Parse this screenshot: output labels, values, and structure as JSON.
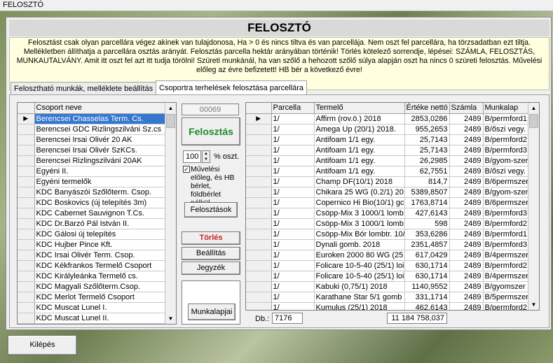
{
  "window_title": "FELOSZTÓ",
  "header_title": "FELOSZTÓ",
  "info_text": "Felosztást csak olyan parcellára végez akinek van tulajdonosa, Ha > 0 és nincs tiltva és van parcellája. Nem oszt fel parcellára, ha törzsadatban ezt tiltja. Mellékletben állíthatja a parcellára osztás arányát. Felosztás parcella hektár arányában történik! Törlés kötelező sorrendje, lépései: SZÁMLA, FELOSZTÁS, MUNKAUTALVÁNY. Amit itt oszt fel azt itt tudja törölni! Szüreti munkánál, ha van szőlő a hehozott szőlő súlya alapján oszt ha nincs 0 szüreti felosztás. Művelési előleg az évre befizetett! HB bér a következő évre!",
  "tabs": [
    {
      "label": "Feloszthatό munkák, melléklete beállítás"
    },
    {
      "label": "Csoportra terhelések felosztása parcellára"
    }
  ],
  "left_grid": {
    "header": "Csoport neve",
    "rows": [
      "Berencsei Chasselas Term. Cs.",
      "Berencsei GDC Rizlingszilváni Sz.cs",
      "Berencsei Irsai Olivér 20 AK",
      "Berencsei Irsai Olivér SzKCs.",
      "Berencsei Rizlingszilváni 20AK",
      "Egyéni II.",
      "Egyéni termelők",
      "KDC Banyászói Szőlőterm. Csop.",
      "KDC Boskovics (új telepítés 3m)",
      "KDC Cabernet Sauvignon T.Cs.",
      "KDC Dr.Barzó Pál István II.",
      "KDC Gálosi új telepítés",
      "KDC Hujber Pince Kft.",
      "KDC Irsai Olivér Term. Csop.",
      "KDC Kékfrankos Termelő Csoport",
      "KDC Királyleánka Termelő cs.",
      "KDC Magyali Szőlőterm.Csop.",
      "KDC Merlot Termelő Csoport",
      "KDC Muscat Lunel I.",
      "KDC Muscat Lunel II."
    ]
  },
  "middle": {
    "code": "00069",
    "felosztas_label": "Felosztás",
    "percent_value": "100",
    "percent_label": "% oszt.",
    "checkbox_label": "Művelési előleg, és HB bérlet, földbérlet nélkül.",
    "felosztasok_label": "Felosztások",
    "torles_label": "Törlés",
    "beallitas_label": "Beállítás",
    "jegyzek_label": "Jegyzék",
    "munkalapjai_label": "Munkalapjai"
  },
  "right_grid": {
    "headers": [
      "Parcella",
      "Termelő",
      "Értéke nettó",
      "Számla",
      "Munkalap"
    ],
    "rows": [
      [
        "1/",
        "Affirm (rov.ö.) 2018",
        "2853,0286",
        "2489",
        "B/permford1"
      ],
      [
        "1/",
        "Amega Up (20/1) 2018.",
        "955,2653",
        "2489",
        "B/őszi vegy."
      ],
      [
        "1/",
        "Antifoam 1/1 egy.",
        "25,7143",
        "2489",
        "B/permford2"
      ],
      [
        "1/",
        "Antifoam 1/1 egy.",
        "25,7143",
        "2489",
        "B/permford3"
      ],
      [
        "1/",
        "Antifoam 1/1 egy.",
        "26,2985",
        "2489",
        "B/gyom-szer"
      ],
      [
        "1/",
        "Antifoam 1/1 egy.",
        "62,7551",
        "2489",
        "B/őszi vegy."
      ],
      [
        "1/",
        "Champ DF(10/1) 2018",
        "814,7",
        "2489",
        "B/6permszer"
      ],
      [
        "1/",
        "Chikara 25 WG (0.2/1) 20",
        "5389,8507",
        "2489",
        "B/gyom-szer"
      ],
      [
        "1/",
        "Copernico Hi Bio(10/1) gc",
        "1763,8714",
        "2489",
        "B/6permszer"
      ],
      [
        "1/",
        "Csöpp-Mix 3 1000/1 lomb",
        "427,6143",
        "2489",
        "B/permford3"
      ],
      [
        "1/",
        "Csöpp-Mix 3 1000/1 lomb",
        "598",
        "2489",
        "B/permford2"
      ],
      [
        "1/",
        "Csöpp-Mix Bór lombtr. 10/",
        "353,6286",
        "2489",
        "B/permford1"
      ],
      [
        "1/",
        "Dynali gomb. 2018",
        "2351,4857",
        "2489",
        "B/permford3"
      ],
      [
        "1/",
        "Euroken 2000 80 WG (25",
        "617,0429",
        "2489",
        "B/4permszer"
      ],
      [
        "1/",
        "Folicare 10-5-40 (25/1) loi",
        "630,1714",
        "2489",
        "B/permford2"
      ],
      [
        "1/",
        "Folicare 10-5-40 (25/1) loi",
        "630,1714",
        "2489",
        "B/4permszer"
      ],
      [
        "1/",
        "Kabuki (0,75/1) 2018",
        "1140,9552",
        "2489",
        "B/gyomszer"
      ],
      [
        "1/",
        "Karathane Star 5/1 gomb",
        "331,1714",
        "2489",
        "B/5permszer"
      ],
      [
        "1/",
        "Kumulus (25/1) 2018",
        "462,6143",
        "2489",
        "B/permford2"
      ]
    ]
  },
  "footer": {
    "db_label": "Db.:",
    "db_value": "7176",
    "total_value": "11 184 758,037"
  },
  "kilepes_label": "Kilépés"
}
